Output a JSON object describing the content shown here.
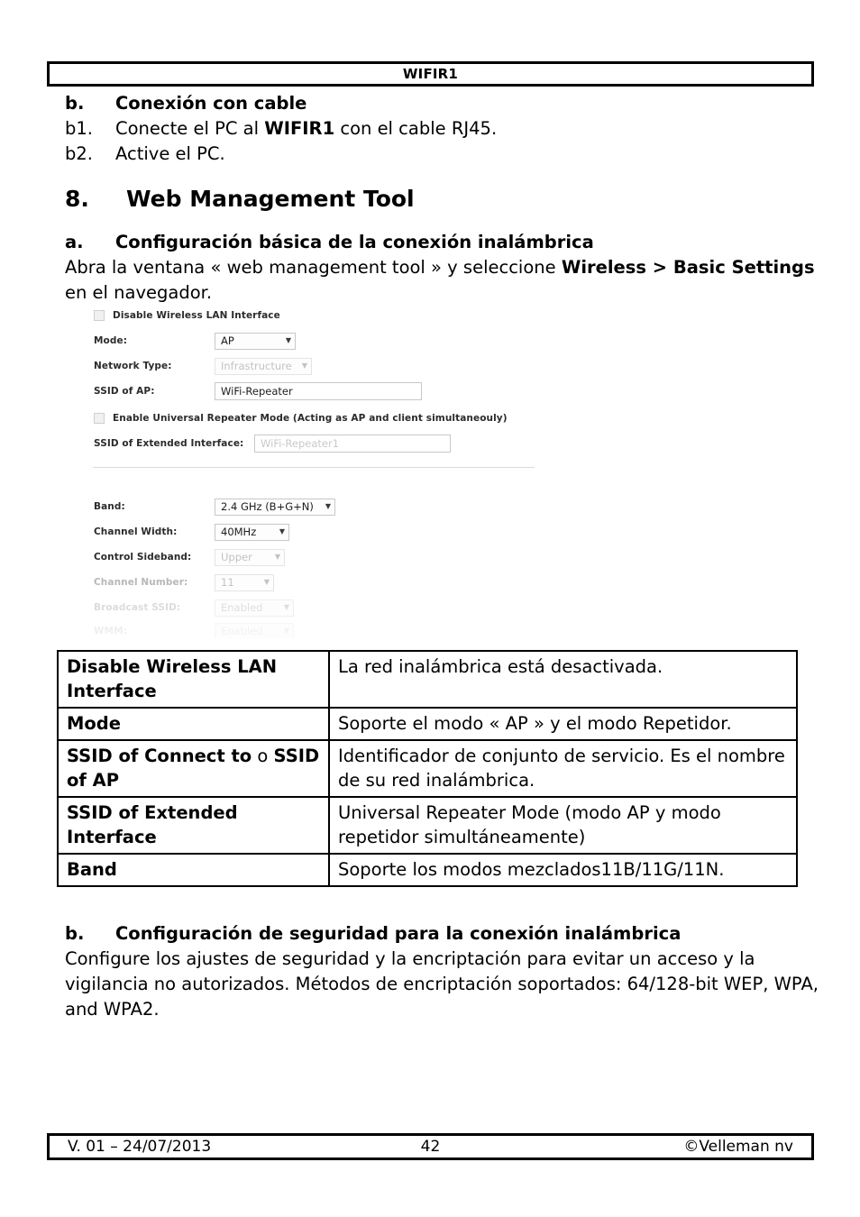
{
  "header": {
    "title": "WIFIR1"
  },
  "intro": {
    "b_marker": "b.",
    "b_title": "Conexión con cable",
    "b1_marker": "b1.",
    "b1_text_pre": "Conecte el PC al ",
    "b1_text_bold": "WIFIR1",
    "b1_text_post": " con el cable RJ45.",
    "b2_marker": "b2.",
    "b2_text": "Active el PC."
  },
  "section": {
    "number": "8.",
    "title": "Web Management Tool",
    "sub_letter": "a.",
    "sub_title": "Configuración básica de la conexión inalámbrica",
    "para_pre": "Abra la ventana « web management tool » y seleccione ",
    "para_bold": "Wireless > Basic Settings",
    "para_post": " en el navegador."
  },
  "router_screenshot": {
    "disable_wlan_label": "Disable Wireless LAN Interface",
    "mode_label": "Mode:",
    "mode_value": "AP",
    "network_type_label": "Network Type:",
    "network_type_value": "Infrastructure",
    "ssid_ap_label": "SSID of AP:",
    "ssid_ap_value": "WiFi-Repeater",
    "universal_repeater_label": "Enable Universal Repeater Mode (Acting as AP and client simultaneouly)",
    "ssid_ext_label": "SSID of Extended Interface:",
    "ssid_ext_placeholder": "WiFi-Repeater1",
    "band_label": "Band:",
    "band_value": "2.4 GHz (B+G+N)",
    "channel_width_label": "Channel Width:",
    "channel_width_value": "40MHz",
    "control_sideband_label": "Control Sideband:",
    "control_sideband_value": "Upper",
    "channel_number_label": "Channel Number:",
    "channel_number_value": "11",
    "broadcast_ssid_label": "Broadcast SSID:",
    "broadcast_ssid_value": "Enabled",
    "wmm_label": "WMM:",
    "wmm_value": "Enabled",
    "caret": "▼"
  },
  "table": {
    "rows": [
      {
        "term": "Disable Wireless LAN Interface",
        "term_plain": "",
        "term_tail": "",
        "desc": "La red inalámbrica está desactivada."
      },
      {
        "term": "Mode",
        "term_plain": "",
        "term_tail": "",
        "desc": "Soporte el modo « AP » y el modo Repetidor."
      },
      {
        "term": "SSID of Connect to",
        "term_plain": " o ",
        "term_tail": "SSID of AP",
        "desc": "Identificador de conjunto de servicio. Es el nombre de su red inalámbrica."
      },
      {
        "term": "SSID of Extended Interface",
        "term_plain": "",
        "term_tail": "",
        "desc": "Universal Repeater Mode (modo AP y modo repetidor simultáneamente)"
      },
      {
        "term": "Band",
        "term_plain": "",
        "term_tail": "",
        "desc": "Soporte los modos mezclados11B/11G/11N."
      }
    ]
  },
  "security": {
    "letter": "b.",
    "title": "Configuración de seguridad para la conexión inalámbrica",
    "body": "Configure los ajustes de seguridad y la encriptación para evitar un acceso y la vigilancia no autorizados. Métodos de encriptación soportados: 64/128-bit WEP, WPA, and WPA2."
  },
  "footer": {
    "left": "V. 01 – 24/07/2013",
    "page": "42",
    "right": "©Velleman nv"
  }
}
